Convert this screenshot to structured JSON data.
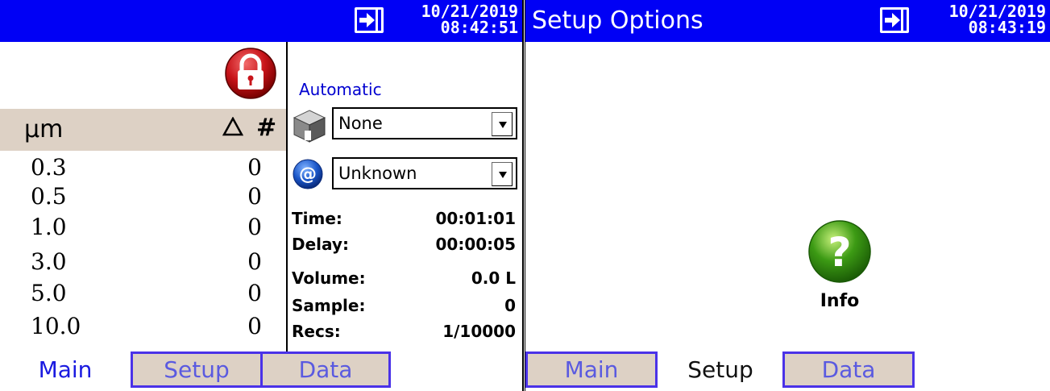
{
  "left_screen": {
    "clock": {
      "date": "10/21/2019",
      "time": "08:42:51"
    },
    "table": {
      "unit_header": "µm",
      "delta_symbol": "Δ",
      "count_header": "#",
      "rows": [
        {
          "size": "0.3",
          "count": "0"
        },
        {
          "size": "0.5",
          "count": "0"
        },
        {
          "size": "1.0",
          "count": "0"
        },
        {
          "size": "3.0",
          "count": "0"
        },
        {
          "size": "5.0",
          "count": "0"
        },
        {
          "size": "10.0",
          "count": "0"
        }
      ]
    },
    "mode_label": "Automatic",
    "location_select": {
      "value": "None"
    },
    "address_select": {
      "value": "Unknown"
    },
    "stats": [
      {
        "label": "Time:",
        "value": "00:01:01"
      },
      {
        "label": "Delay:",
        "value": "00:00:05"
      },
      {
        "label": "Volume:",
        "value": "0.0 L"
      },
      {
        "label": "Sample:",
        "value": "0"
      },
      {
        "label": "Recs:",
        "value": "1/10000"
      }
    ],
    "tabs": [
      {
        "label": "Main",
        "active": true
      },
      {
        "label": "Setup",
        "active": false
      },
      {
        "label": "Data",
        "active": false
      }
    ]
  },
  "right_screen": {
    "title": "Setup Options",
    "clock": {
      "date": "10/21/2019",
      "time": "08:43:19"
    },
    "info_button": {
      "label": "Info"
    },
    "tabs": [
      {
        "label": "Main",
        "active": false
      },
      {
        "label": "Setup",
        "active": true
      },
      {
        "label": "Data",
        "active": false
      }
    ]
  },
  "colors": {
    "titlebar": "#0000f5",
    "tab_inactive_bg": "#ddd1c5",
    "tab_border": "#4a32e8",
    "lock_red": "#c8141a",
    "info_green": "#3c9a14"
  },
  "icons": {
    "titlebar_right": "plug-connection-icon",
    "lock": "lock-icon",
    "location": "cube-icon",
    "address": "at-sign-icon",
    "info": "question-mark-icon"
  }
}
